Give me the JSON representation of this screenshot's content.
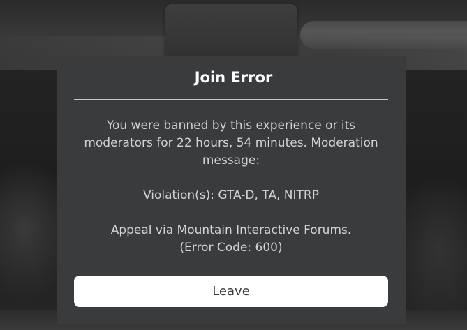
{
  "dialog": {
    "title": "Join Error",
    "message_lines": [
      "You were banned by this experience or its moderators for 22 hours, 54 minutes. Moderation message:",
      "Violation(s): GTA-D, TA, NITRP",
      "Appeal via Mountain Interactive Forums.\n(Error Code: 600)"
    ],
    "leave_label": "Leave"
  },
  "colors": {
    "dialog_background": "#393b3d",
    "title_text": "#ffffff",
    "message_text": "#d4d4d4",
    "button_background": "#ffffff",
    "button_text": "#393b3d"
  }
}
